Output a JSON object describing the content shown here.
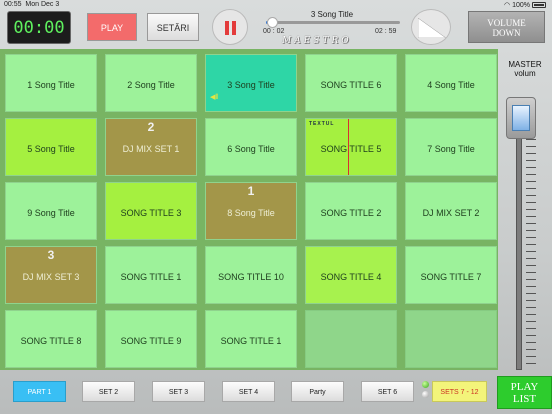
{
  "status_bar": {
    "time": "00:55",
    "date": "Mon Dec 3",
    "battery": "100%"
  },
  "timer": "00:00",
  "play_label": "PLAY",
  "setari_label": "SETĂRI",
  "now_playing": {
    "title": "3 Song Title",
    "elapsed": "00 : 02",
    "remaining": "02 : 59",
    "progress": 0.02
  },
  "logo_text": "MAESTRO",
  "volume_down_label_1": "VOLUME",
  "volume_down_label_2": "DOWN",
  "master_label_1": "MASTER",
  "master_label_2": "volum",
  "master_volume_level": 0.95,
  "tiles": [
    {
      "label": "1 Song Title",
      "color": "default",
      "num": ""
    },
    {
      "label": "2 Song Title",
      "color": "default",
      "num": ""
    },
    {
      "label": "3 Song Title",
      "color": "active",
      "num": ""
    },
    {
      "label": "SONG TITLE 6",
      "color": "default",
      "num": ""
    },
    {
      "label": "4 Song Title",
      "color": "default",
      "num": ""
    },
    {
      "label": "5 Song Title",
      "color": "lime",
      "num": ""
    },
    {
      "label": "DJ MIX SET 1",
      "color": "brown",
      "num": "2"
    },
    {
      "label": "6 Song Title",
      "color": "default",
      "num": ""
    },
    {
      "label": "SONG TITLE 5",
      "color": "lime",
      "num": "",
      "overlay": "TEXTUL"
    },
    {
      "label": "7 Song Title",
      "color": "default",
      "num": ""
    },
    {
      "label": "9 Song Title",
      "color": "default",
      "num": ""
    },
    {
      "label": "SONG TITLE 3",
      "color": "lime",
      "num": ""
    },
    {
      "label": "8 Song Title",
      "color": "brown",
      "num": "1"
    },
    {
      "label": "SONG TITLE 2",
      "color": "default",
      "num": ""
    },
    {
      "label": "DJ MIX SET 2",
      "color": "default",
      "num": ""
    },
    {
      "label": "DJ MIX SET 3",
      "color": "brown",
      "num": "3"
    },
    {
      "label": "SONG TITLE 1",
      "color": "default",
      "num": ""
    },
    {
      "label": "SONG TITLE 10",
      "color": "default",
      "num": ""
    },
    {
      "label": "SONG TITLE 4",
      "color": "lime2",
      "num": ""
    },
    {
      "label": "SONG TITLE 7",
      "color": "default",
      "num": ""
    },
    {
      "label": "SONG TITLE 8",
      "color": "default",
      "num": ""
    },
    {
      "label": "SONG TITLE 9",
      "color": "default",
      "num": ""
    },
    {
      "label": "SONG TITLE 1",
      "color": "default",
      "num": ""
    },
    {
      "label": "",
      "color": "empty",
      "num": ""
    },
    {
      "label": "",
      "color": "empty",
      "num": ""
    }
  ],
  "sets": [
    {
      "label": "PART 1",
      "active": true
    },
    {
      "label": "SET 2",
      "active": false
    },
    {
      "label": "SET 3",
      "active": false
    },
    {
      "label": "SET 4",
      "active": false
    },
    {
      "label": "Party",
      "active": false
    },
    {
      "label": "SET 6",
      "active": false
    }
  ],
  "range_label": "SETS 7 - 12",
  "playlist_label_1": "PLAY",
  "playlist_label_2": "LIST",
  "colors": {
    "default": "#9df29a",
    "lime": "#a5f040",
    "active": "#2ed6a6",
    "brown": "#a39649",
    "play_red": "#f36b6b",
    "set_active": "#39bff4",
    "playlist_green": "#2dcc2d"
  }
}
